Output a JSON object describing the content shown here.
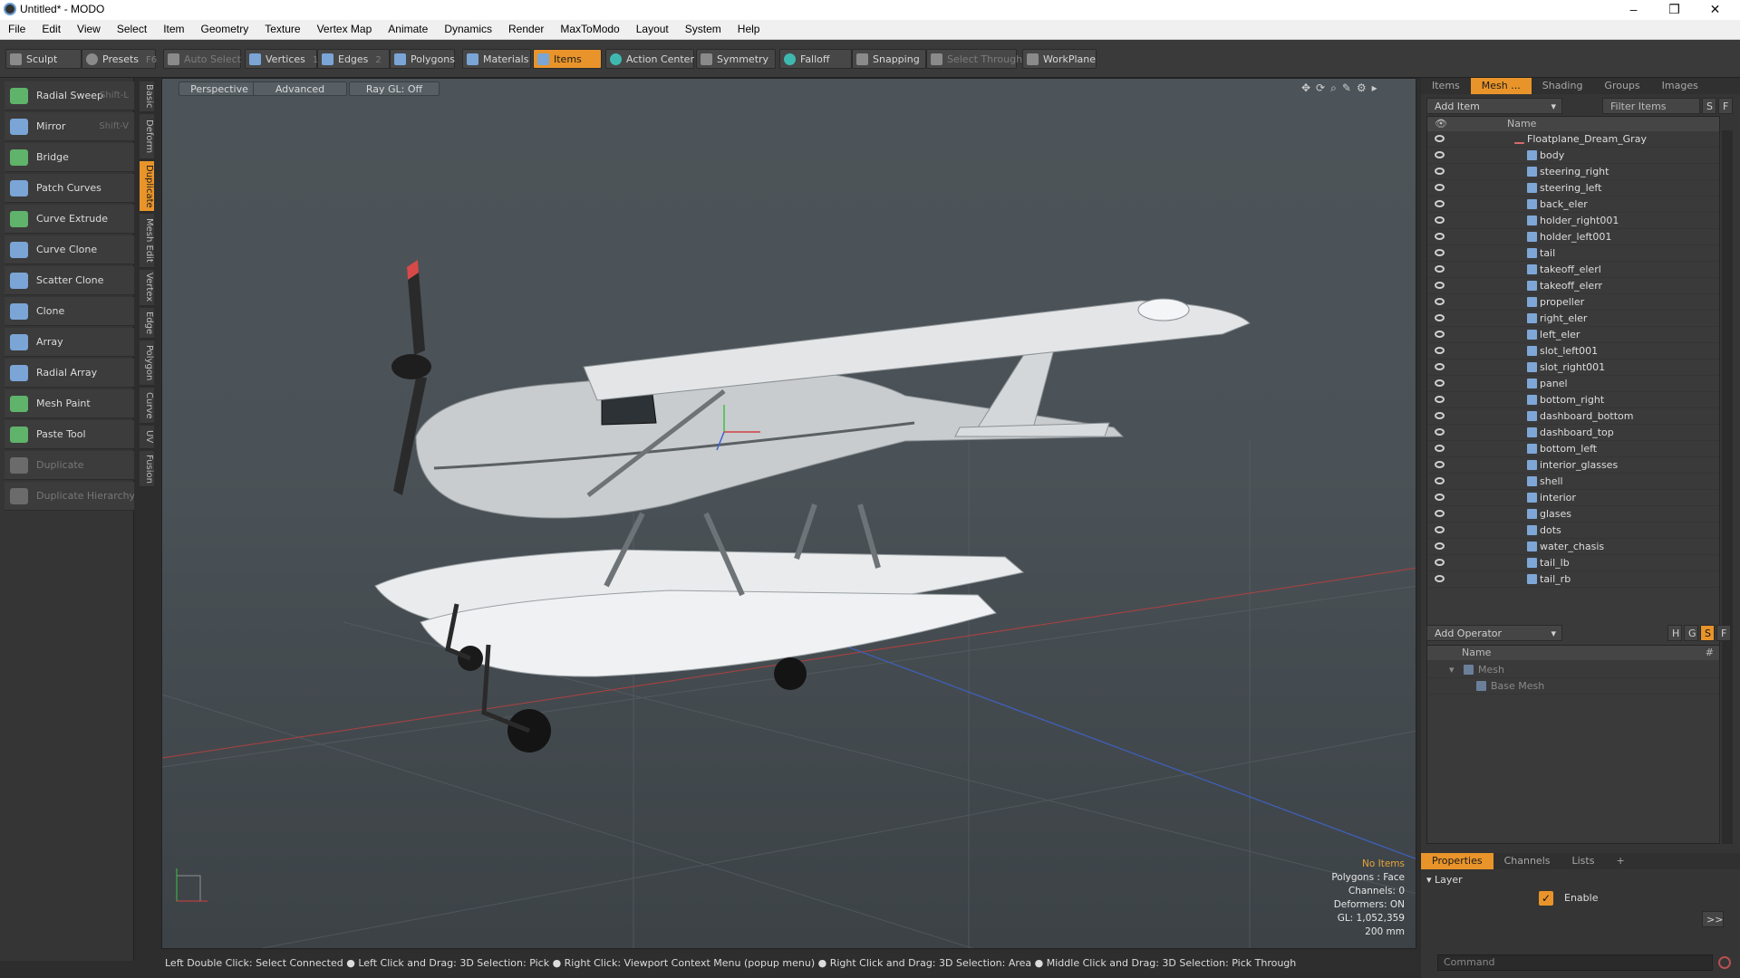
{
  "window": {
    "title": "Untitled* - MODO",
    "min": "–",
    "max": "❒",
    "close": "✕"
  },
  "menu": [
    "File",
    "Edit",
    "View",
    "Select",
    "Item",
    "Geometry",
    "Texture",
    "Vertex Map",
    "Animate",
    "Dynamics",
    "Render",
    "MaxToModo",
    "Layout",
    "System",
    "Help"
  ],
  "toolbar": {
    "sculpt": "Sculpt",
    "presets": "Presets",
    "presets_key": "F6",
    "auto_select": "Auto Select",
    "vertices": "Vertices",
    "vertices_n": "1",
    "edges": "Edges",
    "edges_n": "2",
    "polygons": "Polygons",
    "materials": "Materials",
    "items": "Items",
    "action_center": "Action Center",
    "symmetry": "Symmetry",
    "falloff": "Falloff",
    "snapping": "Snapping",
    "select_through": "Select Through",
    "workplane": "WorkPlane"
  },
  "tools": [
    {
      "label": "Radial Sweep",
      "key": "Shift-L",
      "icon": "radial-sweep-icon",
      "color": "#5fb36a",
      "dim": false
    },
    {
      "label": "Mirror",
      "key": "Shift-V",
      "icon": "mirror-icon",
      "color": "#7aa5d6",
      "dim": false
    },
    {
      "label": "Bridge",
      "key": "",
      "icon": "bridge-icon",
      "color": "#5fb36a",
      "dim": false
    },
    {
      "label": "Patch Curves",
      "key": "",
      "icon": "patch-curves-icon",
      "color": "#7aa5d6",
      "dim": false
    },
    {
      "label": "Curve Extrude",
      "key": "",
      "icon": "curve-extrude-icon",
      "color": "#5fb36a",
      "dim": false
    },
    {
      "label": "Curve Clone",
      "key": "",
      "icon": "curve-clone-icon",
      "color": "#7aa5d6",
      "dim": false
    },
    {
      "label": "Scatter Clone",
      "key": "",
      "icon": "scatter-clone-icon",
      "color": "#7aa5d6",
      "dim": false
    },
    {
      "label": "Clone",
      "key": "",
      "icon": "clone-icon",
      "color": "#7aa5d6",
      "dim": false
    },
    {
      "label": "Array",
      "key": "",
      "icon": "array-icon",
      "color": "#7aa5d6",
      "dim": false
    },
    {
      "label": "Radial Array",
      "key": "",
      "icon": "radial-array-icon",
      "color": "#7aa5d6",
      "dim": false
    },
    {
      "label": "Mesh Paint",
      "key": "",
      "icon": "mesh-paint-icon",
      "color": "#5fb36a",
      "dim": false
    },
    {
      "label": "Paste Tool",
      "key": "",
      "icon": "paste-tool-icon",
      "color": "#5fb36a",
      "dim": false
    },
    {
      "label": "Duplicate",
      "key": "",
      "icon": "duplicate-icon",
      "color": "#6b6b6b",
      "dim": true
    },
    {
      "label": "Duplicate Hierarchy",
      "key": "",
      "icon": "duplicate-hierarchy-icon",
      "color": "#6b6b6b",
      "dim": true
    }
  ],
  "side_tabs": [
    "Basic",
    "Deform",
    "Duplicate",
    "Mesh Edit",
    "Vertex",
    "Edge",
    "Polygon",
    "Curve",
    "UV",
    "Fusion"
  ],
  "side_tab_active": "Duplicate",
  "viewport": {
    "perspective": "Perspective",
    "advanced": "Advanced",
    "raygl": "Ray GL: Off",
    "info": {
      "items": "No Items",
      "polygons": "Polygons : Face",
      "channels": "Channels: 0",
      "deformers": "Deformers: ON",
      "gl": "GL: 1,052,359",
      "scale": "200 mm"
    }
  },
  "status": "Left Double Click: Select Connected ● Left Click and Drag: 3D Selection: Pick ● Right Click: Viewport Context Menu (popup menu) ● Right Click and Drag: 3D Selection: Area ● Middle Click and Drag: 3D Selection: Pick Through",
  "items_panel": {
    "tabs": [
      "Items",
      "Mesh ...",
      "Shading",
      "Groups",
      "Images"
    ],
    "active_tab": "Mesh ...",
    "add_item": "Add Item",
    "filter": "Filter Items",
    "col_name": "Name",
    "root": "Floatplane_Dream_Gray",
    "items": [
      "body",
      "steering_right",
      "steering_left",
      "back_eler",
      "holder_right001",
      "holder_left001",
      "tail",
      "takeoff_elerl",
      "takeoff_elerr",
      "propeller",
      "right_eler",
      "left_eler",
      "slot_left001",
      "slot_right001",
      "panel",
      "bottom_right",
      "dashboard_bottom",
      "dashboard_top",
      "bottom_left",
      "interior_glasses",
      "shell",
      "interior",
      "glases",
      "dots",
      "water_chasis",
      "tail_lb",
      "tail_rb"
    ]
  },
  "operators": {
    "add": "Add Operator",
    "col_name": "Name",
    "hash": "#",
    "mesh": "Mesh",
    "base_mesh": "Base Mesh",
    "flags": [
      "H",
      "G",
      "S",
      "F"
    ]
  },
  "properties": {
    "tabs": [
      "Properties",
      "Channels",
      "Lists"
    ],
    "layer": "Layer",
    "enable": "Enable",
    "more": ">>",
    "command_placeholder": "Command"
  }
}
